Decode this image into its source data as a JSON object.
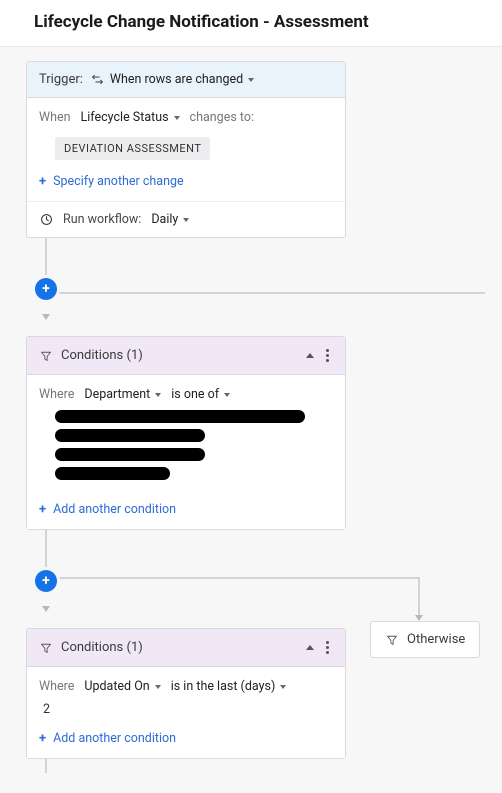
{
  "page": {
    "title": "Lifecycle Change Notification - Assessment"
  },
  "trigger": {
    "label": "Trigger:",
    "type": "When rows are changed",
    "when_label": "When",
    "field": "Lifecycle Status",
    "changes_to_label": "changes to:",
    "value": "DEVIATION ASSESSMENT",
    "specify_another": "Specify another change",
    "run_label": "Run workflow:",
    "run_freq": "Daily"
  },
  "cond1": {
    "title": "Conditions (1)",
    "where_label": "Where",
    "field": "Department",
    "op": "is one of",
    "add_another": "Add another condition"
  },
  "cond2": {
    "title": "Conditions (1)",
    "where_label": "Where",
    "field": "Updated On",
    "op": "is in the last (days)",
    "value": "2",
    "add_another": "Add another condition"
  },
  "otherwise": {
    "label": "Otherwise"
  }
}
